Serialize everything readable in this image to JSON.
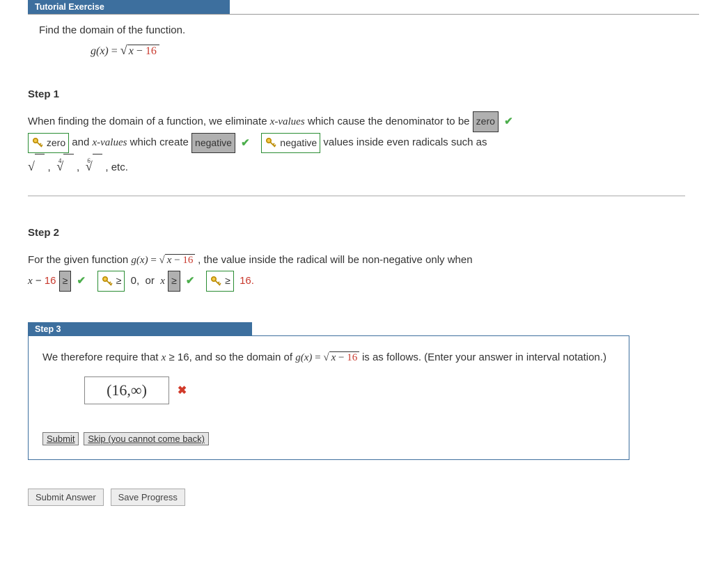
{
  "header": {
    "title": "Tutorial Exercise"
  },
  "prompt": {
    "text": "Find the domain of the function."
  },
  "function": {
    "name": "g(x)",
    "eq": "=",
    "radicand_var": "x",
    "radicand_op": "−",
    "radicand_const": "16"
  },
  "step1": {
    "title": "Step 1",
    "pre": "When finding the domain of a function, we eliminate ",
    "xvals": "x-values",
    "mid1": " which cause the denominator to be ",
    "ans_zero_gray": "zero",
    "ans_zero_green": "zero",
    "mid2": " and ",
    "mid3": " which create ",
    "ans_neg_gray": "negative",
    "ans_neg_green": "negative",
    "mid4": " values inside even radicals such as",
    "roots_line_tail": ",   etc.",
    "root4": "4",
    "root6": "6"
  },
  "step2": {
    "title": "Step 2",
    "pre": "For the given function  ",
    "mid1": ",  the value inside the radical will be non-negative only when",
    "expr_x": "x",
    "expr_minus": "−",
    "expr_const": "16",
    "ans_ge1_gray": "≥",
    "ans_ge1_green": "≥",
    "zero": "0,",
    "or": "or",
    "xlbl": "x",
    "ans_ge2_gray": "≥",
    "ans_ge2_green": "≥",
    "sixteen": "16."
  },
  "step3": {
    "title": "Step 3",
    "pre1": "We therefore require that ",
    "cond_x": "x",
    "cond_ge": "≥",
    "cond_16": "16",
    "mid1": ", and so the domain of  ",
    "mid2": "  is as follows. (Enter your answer in interval notation.)",
    "input_value": "(16,∞)",
    "submit": "Submit",
    "skip": "Skip (you cannot come back)"
  },
  "bottom": {
    "submit_answer": "Submit Answer",
    "save_progress": "Save Progress"
  }
}
